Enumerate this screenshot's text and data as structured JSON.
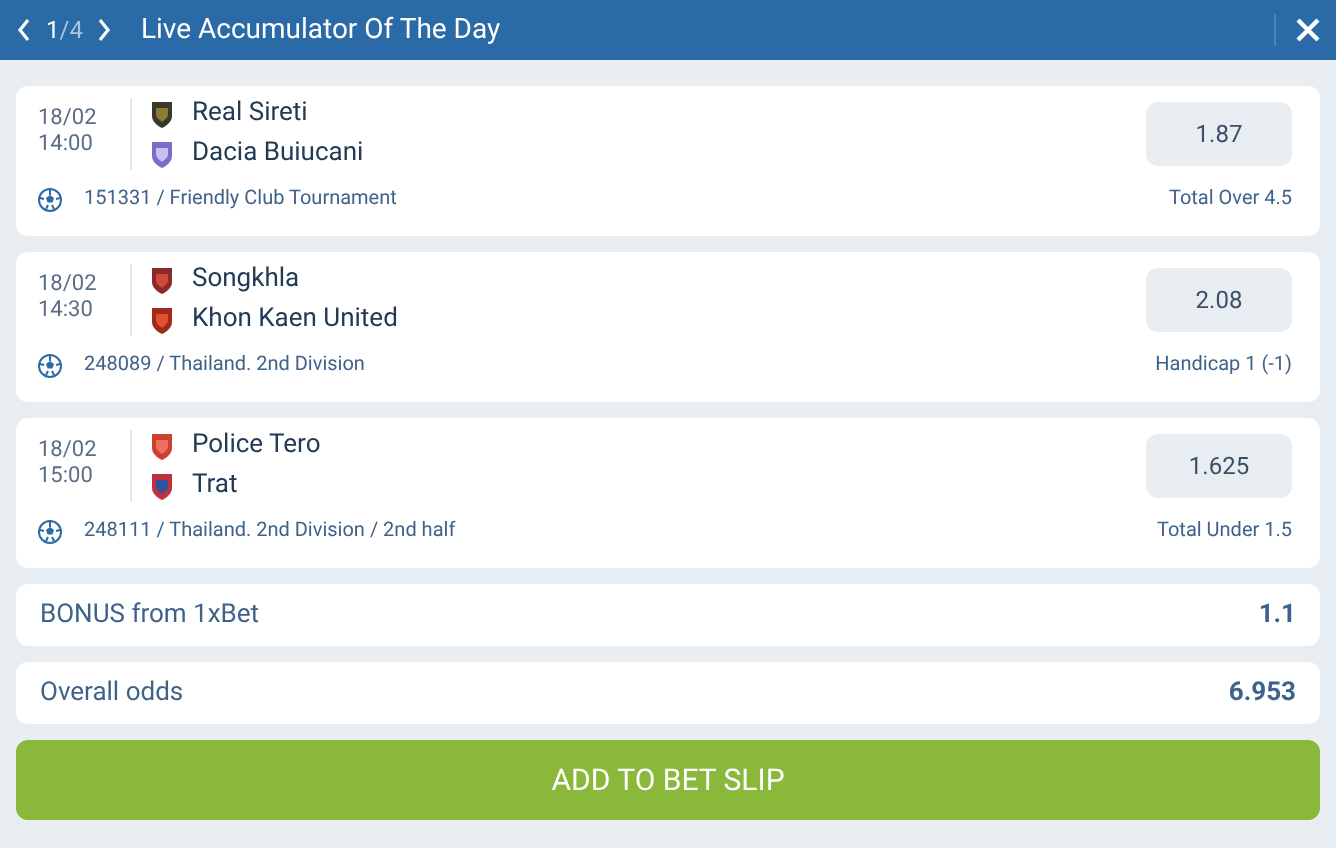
{
  "header": {
    "pager_current": "1",
    "pager_total": "/4",
    "title": "Live Accumulator Of The Day"
  },
  "events": [
    {
      "date": "18/02",
      "time": "14:00",
      "teams": [
        "Real Sireti",
        "Dacia Buiucani"
      ],
      "league": "151331 / Friendly Club Tournament",
      "odds": "1.87",
      "market": "Total Over 4.5"
    },
    {
      "date": "18/02",
      "time": "14:30",
      "teams": [
        "Songkhla",
        "Khon Kaen United"
      ],
      "league": "248089 / Thailand. 2nd Division",
      "odds": "2.08",
      "market": "Handicap 1 (-1)"
    },
    {
      "date": "18/02",
      "time": "15:00",
      "teams": [
        "Police Tero",
        "Trat"
      ],
      "league": "248111 / Thailand. 2nd Division / 2nd half",
      "odds": "1.625",
      "market": "Total Under 1.5"
    }
  ],
  "bonus": {
    "label": "BONUS from 1xBet",
    "value": "1.1"
  },
  "overall": {
    "label": "Overall odds",
    "value": "6.953"
  },
  "button": "ADD TO BET SLIP"
}
